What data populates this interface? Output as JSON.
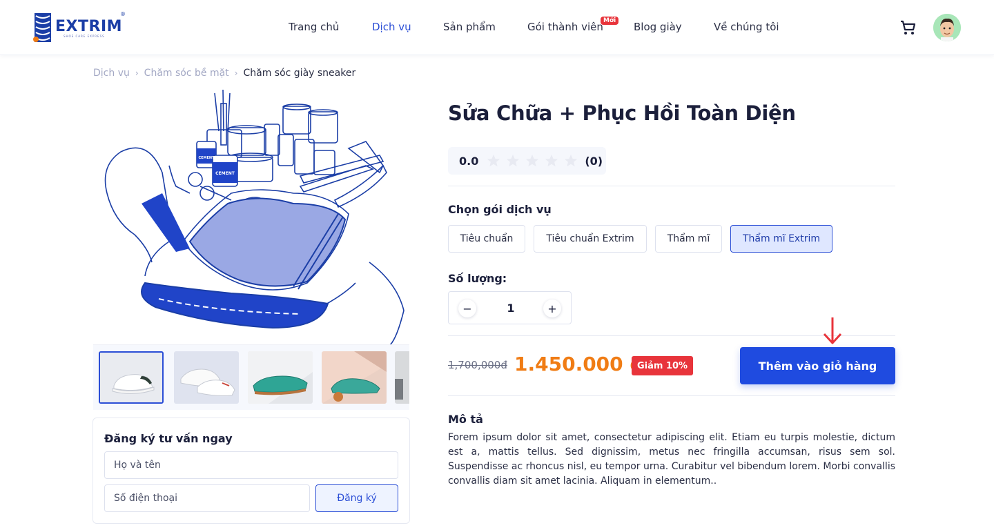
{
  "brand": {
    "name": "EXTRIM",
    "tagline": "SHOE CARE EXPRESS",
    "primary_color": "#1f4be0",
    "accent_color": "#f07c14",
    "danger_color": "#e8343b"
  },
  "nav": {
    "items": [
      {
        "label": "Trang chủ",
        "active": false
      },
      {
        "label": "Dịch vụ",
        "active": true
      },
      {
        "label": "Sản phẩm",
        "active": false
      },
      {
        "label": "Gói thành viên",
        "active": false,
        "badge": "Mới"
      },
      {
        "label": "Blog giày",
        "active": false
      },
      {
        "label": "Về chúng tôi",
        "active": false
      }
    ],
    "cart_icon": "cart-icon",
    "avatar_icon": "user-avatar"
  },
  "breadcrumb": {
    "items": [
      "Dịch vụ",
      "Chăm sóc bề mặt"
    ],
    "current": "Chăm sóc giày sneaker"
  },
  "product": {
    "title": "Sửa Chữa + Phục Hồi Toàn Diện",
    "rating": {
      "score": "0.0",
      "stars_filled": 0,
      "stars_total": 5,
      "count": "(0)"
    },
    "package_label": "Chọn gói dịch vụ",
    "packages": [
      {
        "label": "Tiêu chuẩn",
        "selected": false
      },
      {
        "label": "Tiêu chuẩn Extrim",
        "selected": false
      },
      {
        "label": "Thẩm mĩ",
        "selected": false
      },
      {
        "label": "Thẩm mĩ Extrim",
        "selected": true
      }
    ],
    "quantity_label": "Số lượng:",
    "quantity": "1",
    "old_price": "1,700,000đ",
    "price": "1.450.000 đ",
    "discount": "Giảm 10%",
    "add_to_cart": "Thêm vào giỏ hàng",
    "description_title": "Mô tả",
    "description": "Forem ipsum dolor sit amet, consectetur adipiscing elit. Etiam eu turpis molestie, dictum est a, mattis tellus. Sed dignissim, metus nec fringilla accumsan, risus sem sol. Suspendisse ac rhoncus nisl, eu tempor urna. Curabitur vel bibendum lorem. Morbi convallis convallis diam sit amet lacinia. Aliquam in elementum..",
    "thumbnails": [
      {
        "name": "white-sneaker-thumb",
        "selected": true
      },
      {
        "name": "white-sneakers-pair-thumb",
        "selected": false
      },
      {
        "name": "teal-woven-shoe-thumb",
        "selected": false
      },
      {
        "name": "teal-heeled-shoe-thumb",
        "selected": false
      },
      {
        "name": "shoe-thumb",
        "selected": false
      }
    ]
  },
  "consult": {
    "title": "Đăng ký tư vấn ngay",
    "name_placeholder": "Họ và tên",
    "phone_placeholder": "Số điện thoại",
    "submit": "Đăng ký"
  }
}
